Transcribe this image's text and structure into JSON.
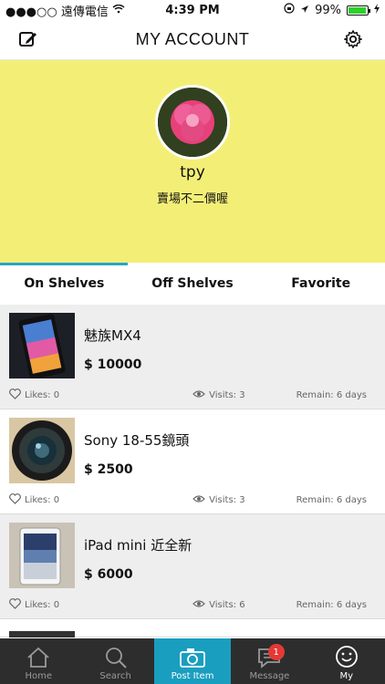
{
  "status": {
    "carrier": "●●●○○ 遠傳電信",
    "time": "4:39 PM",
    "battery": "99%"
  },
  "nav": {
    "title": "MY ACCOUNT"
  },
  "profile": {
    "username": "tpy",
    "tagline": "賣場不二價喔"
  },
  "tabs": [
    {
      "label": "On Shelves"
    },
    {
      "label": "Off Shelves"
    },
    {
      "label": "Favorite"
    }
  ],
  "items": [
    {
      "title": "魅族MX4",
      "price": "$ 10000",
      "likes": "Likes: 0",
      "visits": "Visits: 3",
      "remain": "Remain: 6 days"
    },
    {
      "title": "Sony 18-55鏡頭",
      "price": "$ 2500",
      "likes": "Likes: 0",
      "visits": "Visits: 3",
      "remain": "Remain: 6 days"
    },
    {
      "title": "iPad mini 近全新",
      "price": "$ 6000",
      "likes": "Likes: 0",
      "visits": "Visits: 6",
      "remain": "Remain: 6 days"
    }
  ],
  "tabbar": [
    {
      "label": "Home",
      "icon": "home-icon"
    },
    {
      "label": "Search",
      "icon": "search-icon"
    },
    {
      "label": "Post Item",
      "icon": "camera-icon"
    },
    {
      "label": "Message",
      "icon": "message-icon",
      "badge": "1"
    },
    {
      "label": "My",
      "icon": "smiley-icon"
    }
  ]
}
